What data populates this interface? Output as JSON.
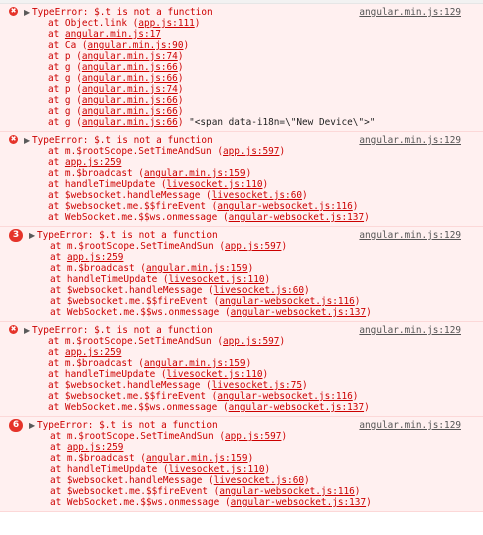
{
  "console": {
    "entries": [
      {
        "badge": "x",
        "message": "TypeError: $.t is not a function",
        "source": "angular.min.js:129",
        "frames": [
          {
            "pre": "at Object.link (",
            "link": "app.js:111",
            "post": ")"
          },
          {
            "pre": "at ",
            "link": "angular.min.js:17",
            "post": ""
          },
          {
            "pre": "at Ca (",
            "link": "angular.min.js:90",
            "post": ")"
          },
          {
            "pre": "at p (",
            "link": "angular.min.js:74",
            "post": ")"
          },
          {
            "pre": "at g (",
            "link": "angular.min.js:66",
            "post": ")"
          },
          {
            "pre": "at g (",
            "link": "angular.min.js:66",
            "post": ")"
          },
          {
            "pre": "at p (",
            "link": "angular.min.js:74",
            "post": ")"
          },
          {
            "pre": "at g (",
            "link": "angular.min.js:66",
            "post": ")"
          },
          {
            "pre": "at g (",
            "link": "angular.min.js:66",
            "post": ")"
          },
          {
            "pre": "at g (",
            "link": "angular.min.js:66",
            "post": ")",
            "tail": " \"<span data-i18n=\\\"New Device\\\">\""
          }
        ]
      },
      {
        "badge": "x",
        "message": "TypeError: $.t is not a function",
        "source": "angular.min.js:129",
        "frames": [
          {
            "pre": "at m.$rootScope.SetTimeAndSun (",
            "link": "app.js:597",
            "post": ")"
          },
          {
            "pre": "at ",
            "link": "app.js:259",
            "post": ""
          },
          {
            "pre": "at m.$broadcast (",
            "link": "angular.min.js:159",
            "post": ")"
          },
          {
            "pre": "at handleTimeUpdate (",
            "link": "livesocket.js:110",
            "post": ")"
          },
          {
            "pre": "at $websocket.handleMessage (",
            "link": "livesocket.js:60",
            "post": ")"
          },
          {
            "pre": "at $websocket.me.$$fireEvent (",
            "link": "angular-websocket.js:116",
            "post": ")"
          },
          {
            "pre": "at WebSocket.me.$$ws.onmessage (",
            "link": "angular-websocket.js:137",
            "post": ")"
          }
        ]
      },
      {
        "badge": "3",
        "message": "TypeError: $.t is not a function",
        "source": "angular.min.js:129",
        "frames": [
          {
            "pre": "at m.$rootScope.SetTimeAndSun (",
            "link": "app.js:597",
            "post": ")"
          },
          {
            "pre": "at ",
            "link": "app.js:259",
            "post": ""
          },
          {
            "pre": "at m.$broadcast (",
            "link": "angular.min.js:159",
            "post": ")"
          },
          {
            "pre": "at handleTimeUpdate (",
            "link": "livesocket.js:110",
            "post": ")"
          },
          {
            "pre": "at $websocket.handleMessage (",
            "link": "livesocket.js:60",
            "post": ")"
          },
          {
            "pre": "at $websocket.me.$$fireEvent (",
            "link": "angular-websocket.js:116",
            "post": ")"
          },
          {
            "pre": "at WebSocket.me.$$ws.onmessage (",
            "link": "angular-websocket.js:137",
            "post": ")"
          }
        ]
      },
      {
        "badge": "x",
        "message": "TypeError: $.t is not a function",
        "source": "angular.min.js:129",
        "frames": [
          {
            "pre": "at m.$rootScope.SetTimeAndSun (",
            "link": "app.js:597",
            "post": ")"
          },
          {
            "pre": "at ",
            "link": "app.js:259",
            "post": ""
          },
          {
            "pre": "at m.$broadcast (",
            "link": "angular.min.js:159",
            "post": ")"
          },
          {
            "pre": "at handleTimeUpdate (",
            "link": "livesocket.js:110",
            "post": ")"
          },
          {
            "pre": "at $websocket.handleMessage (",
            "link": "livesocket.js:75",
            "post": ")"
          },
          {
            "pre": "at $websocket.me.$$fireEvent (",
            "link": "angular-websocket.js:116",
            "post": ")"
          },
          {
            "pre": "at WebSocket.me.$$ws.onmessage (",
            "link": "angular-websocket.js:137",
            "post": ")"
          }
        ]
      },
      {
        "badge": "6",
        "message": "TypeError: $.t is not a function",
        "source": "angular.min.js:129",
        "frames": [
          {
            "pre": "at m.$rootScope.SetTimeAndSun (",
            "link": "app.js:597",
            "post": ")"
          },
          {
            "pre": "at ",
            "link": "app.js:259",
            "post": ""
          },
          {
            "pre": "at m.$broadcast (",
            "link": "angular.min.js:159",
            "post": ")"
          },
          {
            "pre": "at handleTimeUpdate (",
            "link": "livesocket.js:110",
            "post": ")"
          },
          {
            "pre": "at $websocket.handleMessage (",
            "link": "livesocket.js:60",
            "post": ")"
          },
          {
            "pre": "at $websocket.me.$$fireEvent (",
            "link": "angular-websocket.js:116",
            "post": ")"
          },
          {
            "pre": "at WebSocket.me.$$ws.onmessage (",
            "link": "angular-websocket.js:137",
            "post": ")"
          }
        ]
      }
    ]
  }
}
